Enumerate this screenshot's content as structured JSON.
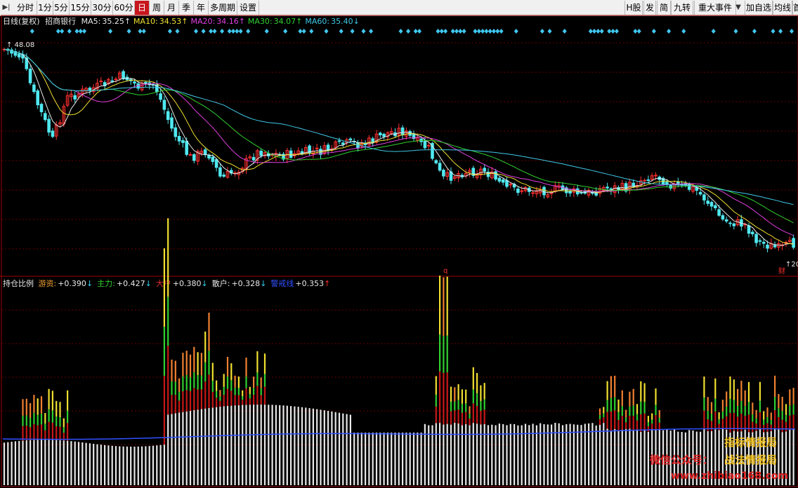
{
  "toolbar": {
    "left_icon": "pin-icon",
    "periods": [
      "分时",
      "1分",
      "5分",
      "15分",
      "30分",
      "60分",
      "日",
      "周",
      "月",
      "季",
      "年",
      "多周期",
      "设置"
    ],
    "active_period": "日",
    "right_items": [
      "H股",
      "发",
      "简",
      "九转",
      "重大事件",
      "加自选",
      "均线",
      "首"
    ]
  },
  "main_info": {
    "period_label": "日线(复权)",
    "stock_name": "招商银行",
    "ma": [
      {
        "label": "MA5:",
        "value": "35.25",
        "arrow": "↑",
        "color": "#e8e8e8"
      },
      {
        "label": "MA10:",
        "value": "34.53",
        "arrow": "↑",
        "color": "#f0e030"
      },
      {
        "label": "MA20:",
        "value": "34.16",
        "arrow": "↑",
        "color": "#e040e0"
      },
      {
        "label": "MA30:",
        "value": "34.07",
        "arrow": "↑",
        "color": "#30d030"
      },
      {
        "label": "MA60:",
        "value": "35.40",
        "arrow": "↓",
        "color": "#40c8e8"
      }
    ]
  },
  "main_chart": {
    "high_marker": "48.08",
    "low_marker": "20",
    "ex_rights_mark": "q",
    "finance_mark": "财"
  },
  "sub_info": {
    "title": "持仓比例",
    "items": [
      {
        "label": "游资:",
        "value": "+0.390",
        "arrow": "↓",
        "color": "#f0a030"
      },
      {
        "label": "主力:",
        "value": "+0.427",
        "arrow": "↓",
        "color": "#30d030"
      },
      {
        "label": "大户",
        "value": "+0.380",
        "arrow": "↓",
        "color": "#e03030"
      },
      {
        "label": "散户:",
        "value": "+0.328",
        "arrow": "↓",
        "color": "#e8e8e8"
      },
      {
        "label": "警戒线",
        "value": "+0.353",
        "arrow": "↑",
        "color": "#3050ff"
      }
    ]
  },
  "watermark": {
    "line1": "指标情报局",
    "line2_left": "微信公众号：",
    "line2_right": "战法情报局",
    "line3": "www.zhibiao168.com"
  },
  "colors": {
    "up": "#ff3030",
    "down": "#50e8f0",
    "bg": "#000000",
    "grid": "#7a0000"
  }
}
